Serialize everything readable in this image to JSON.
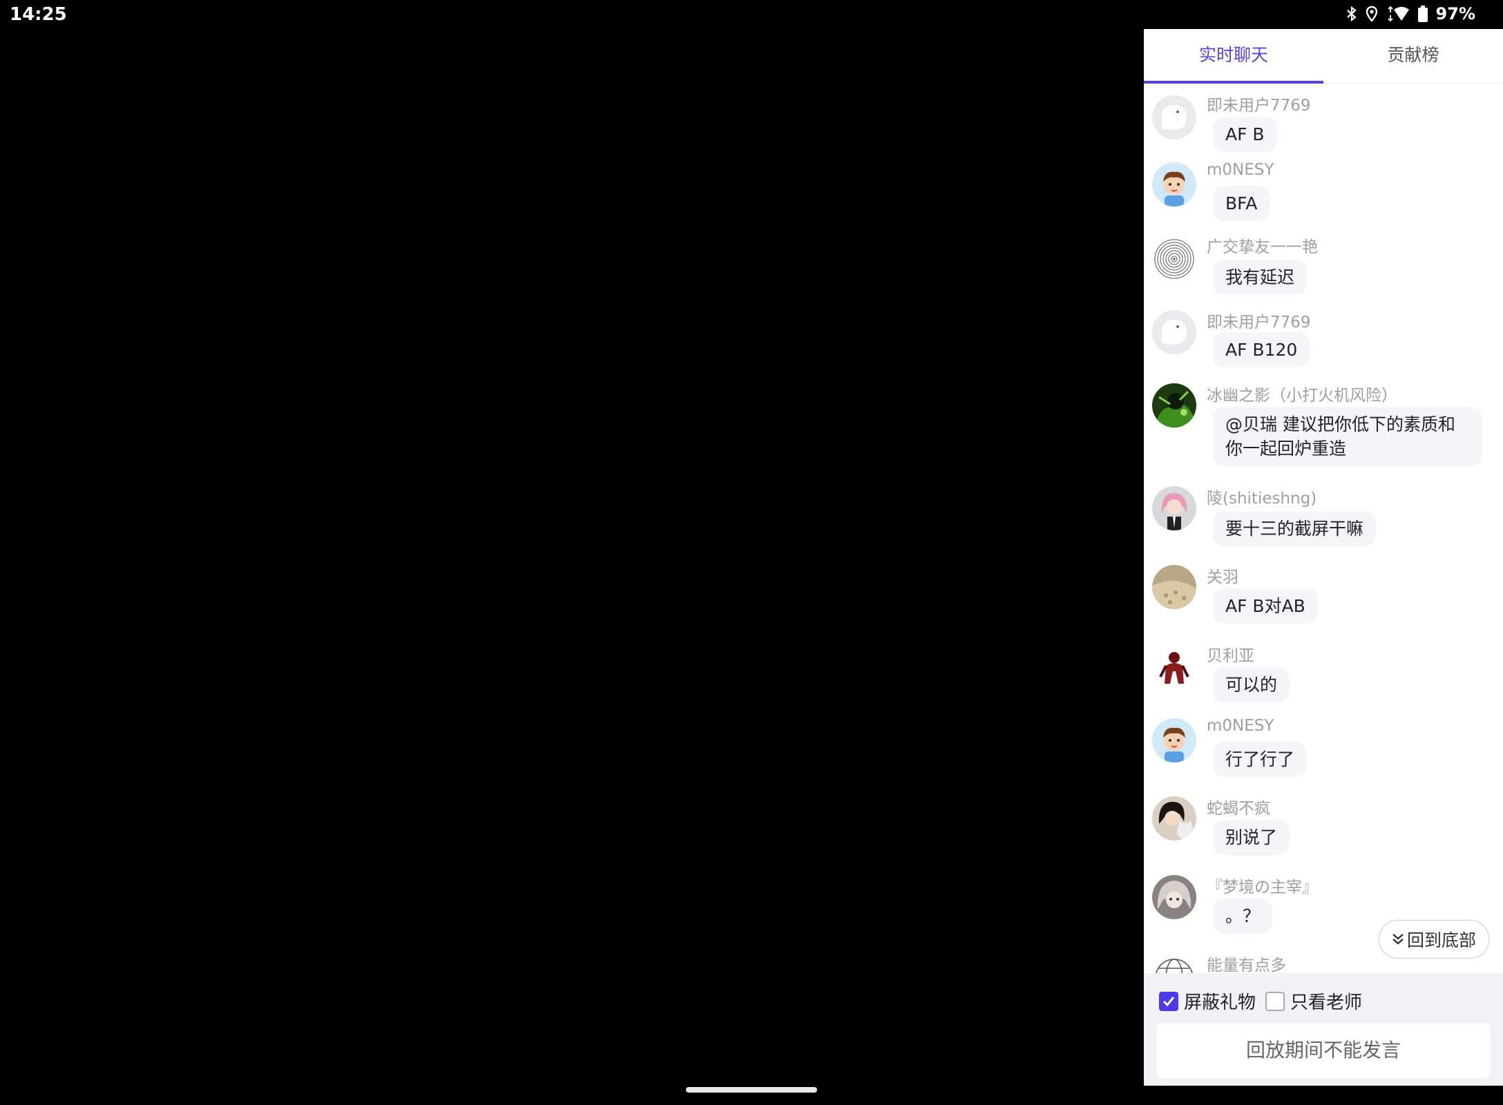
{
  "status_bar": {
    "time": "14:25",
    "battery": "97%"
  },
  "tabs": [
    {
      "label": "实时聊天"
    },
    {
      "label": "贡献榜"
    }
  ],
  "messages": [
    {
      "user": "即未用户7769",
      "text": "AF B"
    },
    {
      "user": "m0NESY",
      "text": "BFA"
    },
    {
      "user": "广交挚友一一艳",
      "text": "我有延迟"
    },
    {
      "user": "即未用户7769",
      "text": "AF B120"
    },
    {
      "user": "冰幽之影（小打火机风险）",
      "text": "@贝瑞  建议把你低下的素质和你一起回炉重造"
    },
    {
      "user": "陵(shitieshng)",
      "text": "要十三的截屏干嘛"
    },
    {
      "user": "关羽",
      "text": "AF B对AB"
    },
    {
      "user": "贝利亚",
      "text": "可以的"
    },
    {
      "user": "m0NESY",
      "text": "行了行了"
    },
    {
      "user": "蛇蝎不疯",
      "text": "别说了"
    },
    {
      "user": "『梦境の主宰』",
      "text": "。？"
    },
    {
      "user": "能量有点多",
      "text": ""
    }
  ],
  "back_to_bottom": "回到底部",
  "options": {
    "block_gifts": "屏蔽礼物",
    "teacher_only": "只看老师"
  },
  "input_placeholder": "回放期间不能发言",
  "colors": {
    "accent": "#5b3ee6",
    "checkbox": "#4b3ae6"
  }
}
